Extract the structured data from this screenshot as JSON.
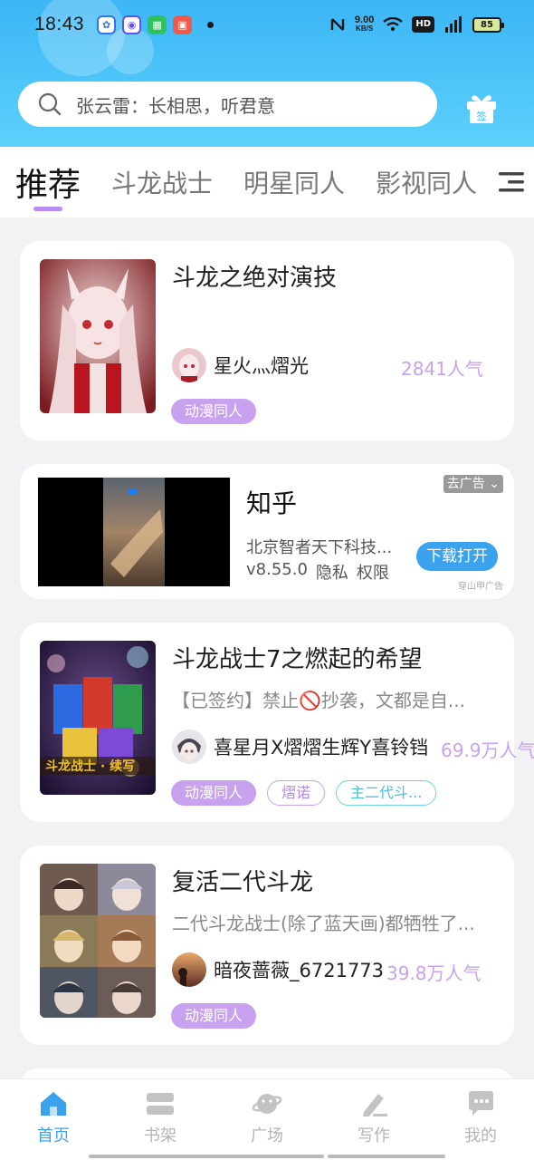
{
  "status_bar": {
    "time": "18:43",
    "notifications": [
      {
        "icon": "baidu-icon",
        "color": "#3a6ff5",
        "glyph": "🐾"
      },
      {
        "icon": "browser-icon",
        "color": "#6a4cf0",
        "glyph": "◎"
      },
      {
        "icon": "wechat-icon",
        "color": "#2fc15b",
        "glyph": "☺"
      },
      {
        "icon": "app-icon",
        "color": "#f15a4a",
        "glyph": "邑"
      }
    ],
    "speed_value": "9.00",
    "speed_unit": "KB/S",
    "signal_label": "4G",
    "hd_label": "HD",
    "battery": "85"
  },
  "header": {
    "search_placeholder": "张云雷：长相思，听君意",
    "sign_label": "签"
  },
  "tabs": [
    {
      "label": "推荐",
      "active": true
    },
    {
      "label": "斗龙战士",
      "active": false
    },
    {
      "label": "明星同人",
      "active": false
    },
    {
      "label": "影视同人",
      "active": false
    }
  ],
  "feed": [
    {
      "title": "斗龙之绝对演技",
      "author": "星火灬熠光",
      "popularity": "2841人气",
      "tags": [
        "动漫同人"
      ]
    },
    {
      "ad": true,
      "title": "知乎",
      "description": "北京智者天下科技...",
      "version": "v8.55.0",
      "privacy": "隐私",
      "permission": "权限",
      "close_label": "去广告",
      "download_label": "下载打开",
      "source_label": "穿山甲广告"
    },
    {
      "title": "斗龙战士7之燃起的希望",
      "description": "【已签约】禁止🚫抄袭，文都是自...",
      "author": "喜星月X熠熠生辉Y喜铃铛",
      "popularity": "69.9万人气",
      "tags": [
        "动漫同人",
        "熠诺",
        "主二代斗..."
      ]
    },
    {
      "title": "复活二代斗龙",
      "description": "二代斗龙战士(除了蓝天画)都牺牲了...",
      "author": "暗夜蔷薇_6721773",
      "popularity": "39.8万人气",
      "tags": [
        "动漫同人"
      ]
    }
  ],
  "bottom_nav": [
    {
      "label": "首页",
      "icon": "home-icon",
      "active": true
    },
    {
      "label": "书架",
      "icon": "bookshelf-icon",
      "active": false
    },
    {
      "label": "广场",
      "icon": "planet-icon",
      "active": false
    },
    {
      "label": "写作",
      "icon": "pen-icon",
      "active": false
    },
    {
      "label": "我的",
      "icon": "chat-bubble-icon",
      "active": false
    }
  ],
  "colors": {
    "header_blue": "#3cb6f5",
    "accent_purple": "#c9a2ef",
    "accent_blue": "#3ba3ee"
  }
}
